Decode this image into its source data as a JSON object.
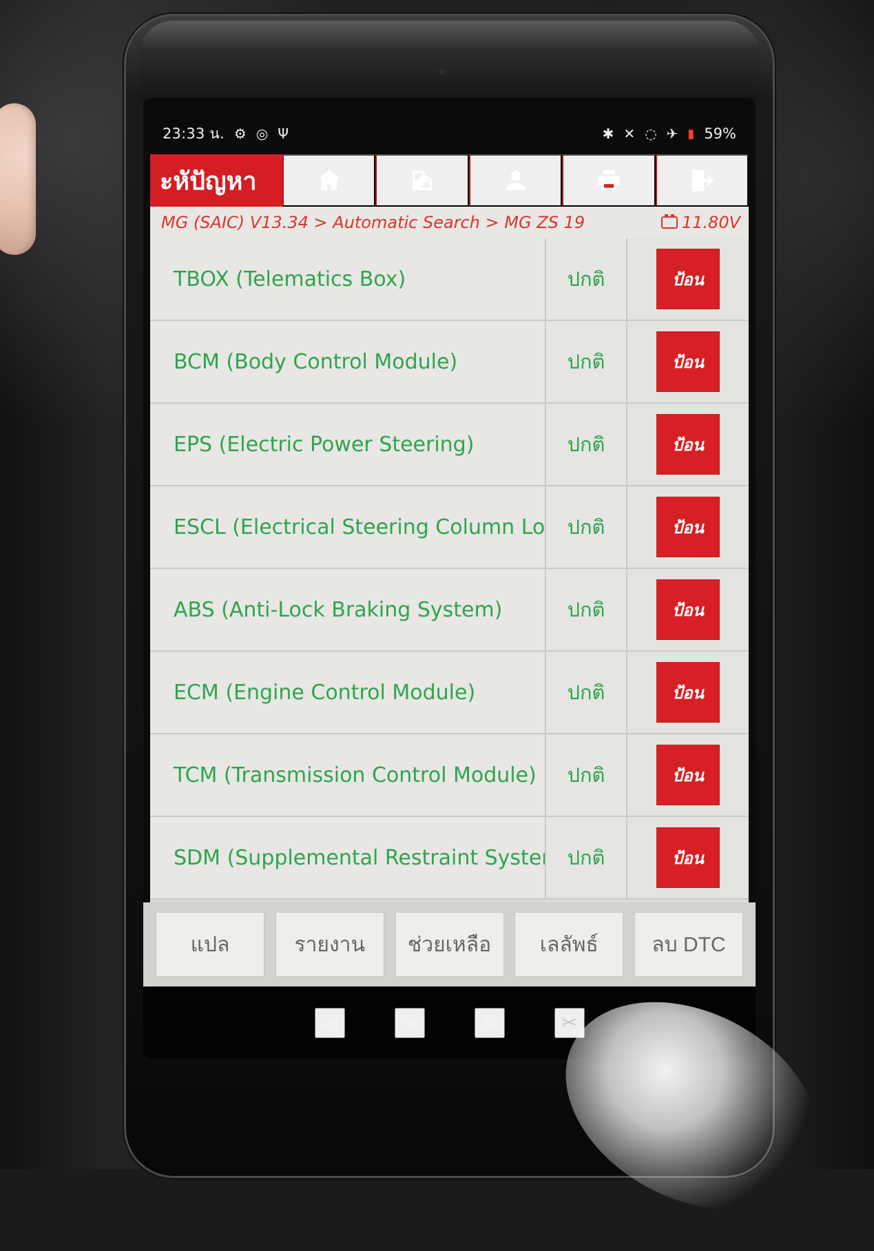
{
  "status_bar": {
    "time": "23:33 น.",
    "left_icons": [
      "gear-icon",
      "bluetooth-scan-icon",
      "usb-icon"
    ],
    "right_icons": [
      "bluetooth-icon",
      "mute-icon",
      "wifi-icon",
      "airplane-mode-icon",
      "battery-icon"
    ],
    "battery_percent": "59%"
  },
  "app_bar": {
    "title": "ะหัปัญหา",
    "toolbar": [
      "home-icon",
      "edit-icon",
      "user-icon",
      "print-icon",
      "exit-icon"
    ]
  },
  "breadcrumb": {
    "path": "MG (SAIC) V13.34 > Automatic Search > MG ZS 19",
    "voltage": "11.80V"
  },
  "modules": [
    {
      "name": "TBOX (Telematics Box)",
      "status": "ปกติ",
      "action": "ป้อน"
    },
    {
      "name": "BCM (Body Control Module)",
      "status": "ปกติ",
      "action": "ป้อน"
    },
    {
      "name": "EPS (Electric Power Steering)",
      "status": "ปกติ",
      "action": "ป้อน"
    },
    {
      "name": "ESCL (Electrical Steering Column Lock)",
      "status": "ปกติ",
      "action": "ป้อน"
    },
    {
      "name": "ABS (Anti-Lock Braking System)",
      "status": "ปกติ",
      "action": "ป้อน"
    },
    {
      "name": "ECM (Engine Control Module)",
      "status": "ปกติ",
      "action": "ป้อน"
    },
    {
      "name": "TCM (Transmission Control Module)",
      "status": "ปกติ",
      "action": "ป้อน"
    },
    {
      "name": "SDM (Supplemental Restraint System)",
      "status": "ปกติ",
      "action": "ป้อน"
    }
  ],
  "footer": {
    "buttons": [
      "แปล",
      "รายงาน",
      "ช่วยเหลือ",
      "เลลัพธ์",
      "ลบ DTC"
    ]
  },
  "nav_bar": {
    "buttons": [
      "back-icon",
      "home-icon",
      "recents-icon",
      "screenshot-icon"
    ]
  },
  "colors": {
    "primary_red": "#d41e24",
    "status_green": "#2fa44f",
    "breadcrumb_red": "#d9362e"
  }
}
